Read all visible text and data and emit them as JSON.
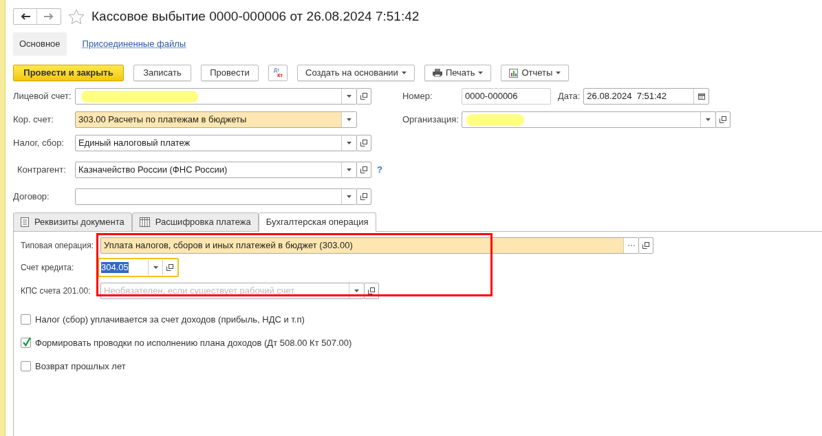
{
  "window": {
    "title": "Кассовое выбытие 0000-000006 от 26.08.2024 7:51:42"
  },
  "nav_tabs": [
    {
      "label": "Основное",
      "selected": true
    },
    {
      "label": "Присоединенные файлы",
      "selected": false
    }
  ],
  "toolbar": {
    "buttons": [
      {
        "kind": "primary",
        "label": "Провести и закрыть"
      },
      {
        "kind": "plain",
        "label": "Записать"
      },
      {
        "kind": "plain",
        "label": "Провести"
      },
      {
        "kind": "dtkt",
        "label_top": "Дт",
        "label_bottom": "Кт"
      },
      {
        "kind": "menu",
        "label": "Создать на основании"
      },
      {
        "kind": "print",
        "label": "Печать"
      },
      {
        "kind": "report",
        "label": "Отчеты"
      }
    ]
  },
  "fields": [
    {
      "label": "Лицевой счет:",
      "redacted": true,
      "highlighted": false,
      "open": true,
      "help": false
    },
    {
      "label": "Кор. счет:",
      "value": "303.00 Расчеты по платежам в бюджеты",
      "redacted": false,
      "highlighted": true,
      "open": false,
      "help": false
    },
    {
      "label": "Налог, сбор:",
      "value": "Единый налоговый платеж",
      "redacted": false,
      "highlighted": false,
      "open": true,
      "help": false
    },
    {
      "label": "Контрагент:",
      "value": "Казначейство России (ФНС России)",
      "redacted": false,
      "highlighted": false,
      "open": true,
      "help": true,
      "help_text": "?"
    },
    {
      "label": "Договор:",
      "redacted": false,
      "highlighted": false,
      "open": true,
      "help": false
    }
  ],
  "number": {
    "label": "Номер:",
    "value": "0000-000006"
  },
  "date": {
    "label": "Дата:",
    "value": "26.08.2024  7:51:42"
  },
  "organization": {
    "label": "Организация:",
    "redacted": true
  },
  "tabs": [
    {
      "label": "Реквизиты документа",
      "kind": "doc",
      "selected": false
    },
    {
      "label": "Расшифровка платежа",
      "kind": "table",
      "selected": false
    },
    {
      "label": "Бухгалтерская операция",
      "kind": "none",
      "selected": true
    }
  ],
  "operation": {
    "label": "Типовая операция:",
    "value": "Уплата налогов, сборов и иных платежей в бюджет (303.00)"
  },
  "credit_account": {
    "label": "Счет кредита:",
    "value": "304.05",
    "focused": true
  },
  "kps": {
    "label": "КПС счета 201.00:",
    "placeholder": "Необязателен, если существует рабочий счет"
  },
  "checkboxes": [
    {
      "label": "Налог (сбор) уплачивается за счет доходов (прибыль, НДС и т.п)",
      "checked": false
    },
    {
      "label": "Формировать проводки по исполнению плана доходов (Дт 508.00 Кт 507.00)",
      "checked": true
    },
    {
      "label": "Возврат прошлых лет",
      "checked": false
    }
  ]
}
